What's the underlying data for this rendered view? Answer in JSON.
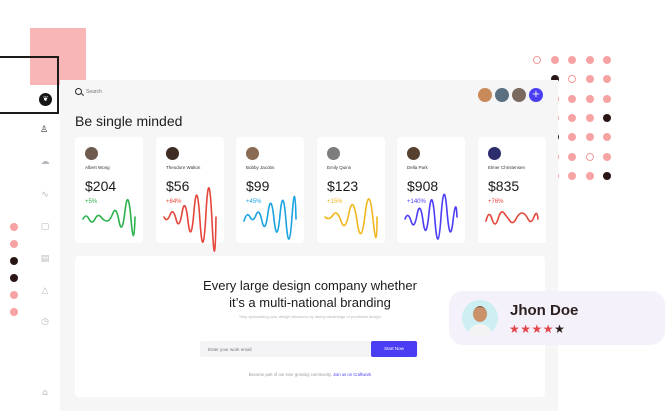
{
  "search": {
    "placeholder": "Search"
  },
  "page": {
    "heading": "Be single minded"
  },
  "cards": [
    {
      "name": "Albert Wong",
      "amount": "$204",
      "change": "+5%",
      "color": "#2bb24c",
      "avatar_color": "#6e5a4f"
    },
    {
      "name": "Theodore Walton",
      "amount": "$56",
      "change": "+84%",
      "color": "#e5463b",
      "avatar_color": "#3e2b22"
    },
    {
      "name": "Bobby Jacobs",
      "amount": "$99",
      "change": "+45%",
      "color": "#1ba3e0",
      "avatar_color": "#8a6a52"
    },
    {
      "name": "Emily Quinn",
      "amount": "$123",
      "change": "+15%",
      "color": "#f2b61f",
      "avatar_color": "#7d7d7d"
    },
    {
      "name": "Della Park",
      "amount": "$908",
      "change": "+140%",
      "color": "#4b3df4",
      "avatar_color": "#56402f"
    },
    {
      "name": "Elmer Christensen",
      "amount": "$835",
      "change": "+76%",
      "color": "#e5463b",
      "avatar_color": "#2d2d6e"
    }
  ],
  "cta": {
    "title_line1": "Every large design company whether",
    "title_line2": "it’s a multi-national branding",
    "subtitle": "Stop speculating your design decisions by taking advantage of predictive design",
    "email_placeholder": "Enter your work email",
    "button_label": "Start Now",
    "footer_text": "Become part of our ever growing community.",
    "footer_link": "Join us on Craftwork"
  },
  "profile": {
    "name": "Jhon Doe",
    "rating": 4,
    "rating_max": 5
  },
  "colors": {
    "accent": "#4b3df4",
    "pink": "#f7a3a3",
    "dark": "#2a1515"
  },
  "icons": {
    "logo": "leaf-logo-icon",
    "search": "search-icon",
    "plus": "plus-icon",
    "sidebar": [
      "user-icon",
      "cloud-icon",
      "activity-icon",
      "message-icon",
      "calendar-icon",
      "bell-icon",
      "clock-icon",
      "home-icon"
    ]
  }
}
